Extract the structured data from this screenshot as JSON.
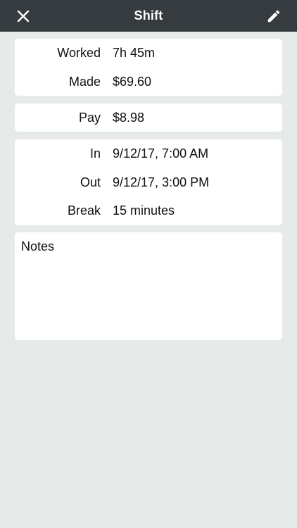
{
  "header": {
    "title": "Shift",
    "close_icon": "close-icon",
    "edit_icon": "pencil-icon"
  },
  "summary": {
    "rows": [
      {
        "label": "Worked",
        "value": "7h 45m"
      },
      {
        "label": "Made",
        "value": "$69.60"
      }
    ]
  },
  "pay": {
    "label": "Pay",
    "value": "$8.98"
  },
  "times": {
    "rows": [
      {
        "label": "In",
        "value": "9/12/17, 7:00 AM"
      },
      {
        "label": "Out",
        "value": "9/12/17, 3:00 PM"
      },
      {
        "label": "Break",
        "value": "15 minutes"
      }
    ]
  },
  "notes": {
    "title": "Notes"
  },
  "colors": {
    "nav_background": "#363b3f",
    "page_background": "#e6ebea",
    "card_background": "#ffffff",
    "text": "#111111"
  }
}
